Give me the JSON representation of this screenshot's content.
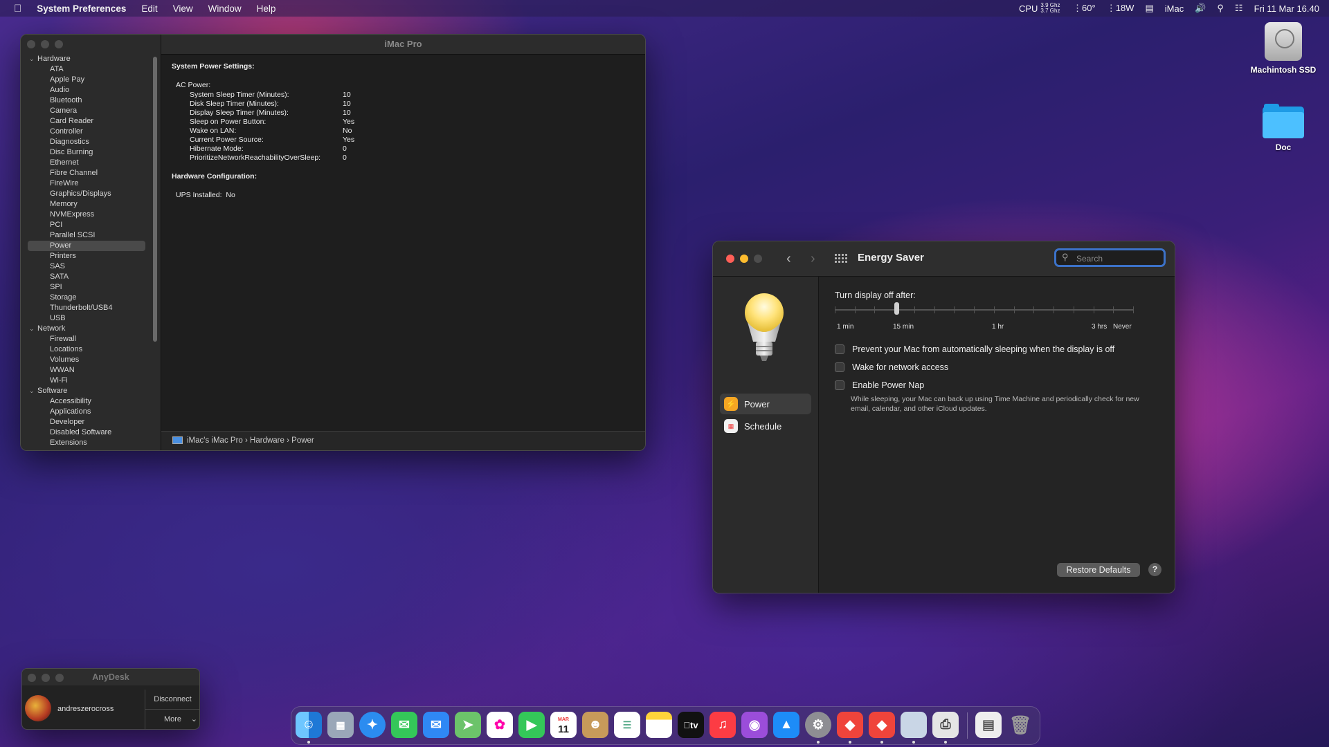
{
  "menubar": {
    "app_name": "System Preferences",
    "menus": [
      "Edit",
      "View",
      "Window",
      "Help"
    ],
    "cpu_label": "CPU",
    "cpu_freq_1": "3.9 Ghz",
    "cpu_freq_2": "3.7 Ghz",
    "temperature": "60°",
    "power": "18W",
    "host": "iMac",
    "datetime": "Fri 11 Mar  16.40"
  },
  "sysinfo": {
    "title": "iMac Pro",
    "tree": {
      "hardware_label": "Hardware",
      "hardware": [
        "ATA",
        "Apple Pay",
        "Audio",
        "Bluetooth",
        "Camera",
        "Card Reader",
        "Controller",
        "Diagnostics",
        "Disc Burning",
        "Ethernet",
        "Fibre Channel",
        "FireWire",
        "Graphics/Displays",
        "Memory",
        "NVMExpress",
        "PCI",
        "Parallel SCSI",
        "Power",
        "Printers",
        "SAS",
        "SATA",
        "SPI",
        "Storage",
        "Thunderbolt/USB4",
        "USB"
      ],
      "network_label": "Network",
      "network": [
        "Firewall",
        "Locations",
        "Volumes",
        "WWAN",
        "Wi-Fi"
      ],
      "software_label": "Software",
      "software": [
        "Accessibility",
        "Applications",
        "Developer",
        "Disabled Software",
        "Extensions"
      ]
    },
    "heading_power": "System Power Settings:",
    "ac_power": "AC Power:",
    "settings": [
      {
        "k": "System Sleep Timer (Minutes):",
        "v": "10"
      },
      {
        "k": "Disk Sleep Timer (Minutes):",
        "v": "10"
      },
      {
        "k": "Display Sleep Timer (Minutes):",
        "v": "10"
      },
      {
        "k": "Sleep on Power Button:",
        "v": "Yes"
      },
      {
        "k": "Wake on LAN:",
        "v": "No"
      },
      {
        "k": "Current Power Source:",
        "v": "Yes"
      },
      {
        "k": "Hibernate Mode:",
        "v": "0"
      },
      {
        "k": "PrioritizeNetworkReachabilityOverSleep:",
        "v": "0"
      }
    ],
    "heading_hw": "Hardware Configuration:",
    "ups_label": "UPS Installed:",
    "ups_value": "No",
    "path_1": "iMac's iMac Pro",
    "path_2": "Hardware",
    "path_3": "Power",
    "sep": "›"
  },
  "energy": {
    "title": "Energy Saver",
    "search_placeholder": "Search",
    "nav_power": "Power",
    "nav_schedule": "Schedule",
    "display_off_label": "Turn display off after:",
    "slider_position": 0.205,
    "tick_labels": [
      {
        "text": "1 min",
        "pos": 0.0
      },
      {
        "text": "15 min",
        "pos": 0.212
      },
      {
        "text": "1 hr",
        "pos": 0.545
      },
      {
        "text": "3 hrs",
        "pos": 0.878
      },
      {
        "text": "Never",
        "pos": 1.0
      }
    ],
    "opt_prevent": "Prevent your Mac from automatically sleeping when the display is off",
    "opt_wake": "Wake for network access",
    "opt_nap": "Enable Power Nap",
    "nap_desc": "While sleeping, your Mac can back up using Time Machine and periodically check for new email, calendar, and other iCloud updates.",
    "restore": "Restore Defaults",
    "help": "?"
  },
  "desktop": {
    "hdd_label": "Machintosh SSD",
    "folder_label": "Doc"
  },
  "anydesk": {
    "title": "AnyDesk",
    "user": "andreszerocross",
    "disconnect": "Disconnect",
    "more": "More"
  },
  "dock": {
    "calendar_month": "MAR",
    "calendar_day": "11",
    "tv": "tv"
  }
}
